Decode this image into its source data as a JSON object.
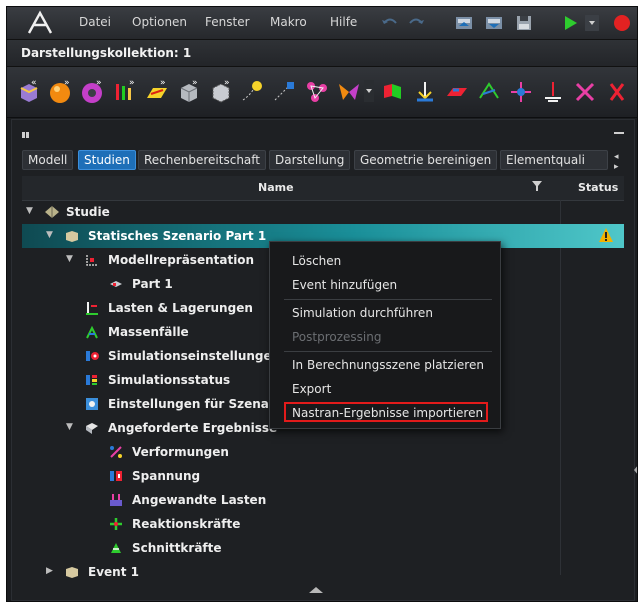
{
  "menu": [
    "Datei",
    "Optionen",
    "Fenster",
    "Makro",
    "Hilfe"
  ],
  "collection_title": "Darstellungskollektion: 1",
  "tabs": [
    "Modell",
    "Studien",
    "Rechenbereitschaft",
    "Darstellung",
    "Geometrie bereinigen",
    "Elementquali"
  ],
  "active_tab": "Studien",
  "tab_scroll": "◂ ▸",
  "columns": {
    "name": "Name",
    "status": "Status",
    "filter_icon": "filter-icon"
  },
  "tree": [
    {
      "label": "Studie",
      "level": 0,
      "expanded": true,
      "icon": "study-icon"
    },
    {
      "label": "Statisches Szenario Part 1",
      "level": 1,
      "expanded": true,
      "selected": true,
      "icon": "scenario-icon",
      "status": "warning"
    },
    {
      "label": "Modellrepräsentation",
      "level": 2,
      "expanded": true,
      "icon": "model-representation-icon"
    },
    {
      "label": "Part 1",
      "level": 3,
      "icon": "part-icon"
    },
    {
      "label": "Lasten & Lagerungen",
      "level": 2,
      "icon": "loads-supports-icon"
    },
    {
      "label": "Massenfälle",
      "level": 2,
      "icon": "mass-cases-icon"
    },
    {
      "label": "Simulationseinstellungen",
      "level": 2,
      "icon": "simulation-settings-icon"
    },
    {
      "label": "Simulationsstatus",
      "level": 2,
      "icon": "simulation-status-icon"
    },
    {
      "label": "Einstellungen für Szenari",
      "level": 2,
      "icon": "scenario-settings-icon"
    },
    {
      "label": "Angeforderte Ergebnisse",
      "level": 2,
      "expanded": true,
      "icon": "requested-results-icon"
    },
    {
      "label": "Verformungen",
      "level": 3,
      "icon": "deformations-icon"
    },
    {
      "label": "Spannung",
      "level": 3,
      "icon": "stress-icon"
    },
    {
      "label": "Angewandte Lasten",
      "level": 3,
      "icon": "applied-loads-icon"
    },
    {
      "label": "Reaktionskräfte",
      "level": 3,
      "icon": "reaction-forces-icon"
    },
    {
      "label": "Schnittkräfte",
      "level": 3,
      "icon": "section-forces-icon"
    },
    {
      "label": "Event 1",
      "level": 1,
      "expanded": false,
      "icon": "event-icon"
    }
  ],
  "context_menu": [
    {
      "label": "Löschen",
      "enabled": true
    },
    {
      "label": "Event hinzufügen",
      "enabled": true
    },
    {
      "label": "Simulation durchführen",
      "enabled": true
    },
    {
      "label": "Postprozessing",
      "enabled": false
    },
    {
      "label": "In Berechnungsszene platzieren",
      "enabled": true
    },
    {
      "label": "Export",
      "enabled": true
    },
    {
      "label": "Nastran-Ergebnisse importieren",
      "enabled": true,
      "highlighted": true
    }
  ],
  "colors": {
    "accent": "#1e6fb8",
    "selection": "#1a8f99",
    "highlight_box": "#e21b1b",
    "warning": "#f2b200"
  }
}
